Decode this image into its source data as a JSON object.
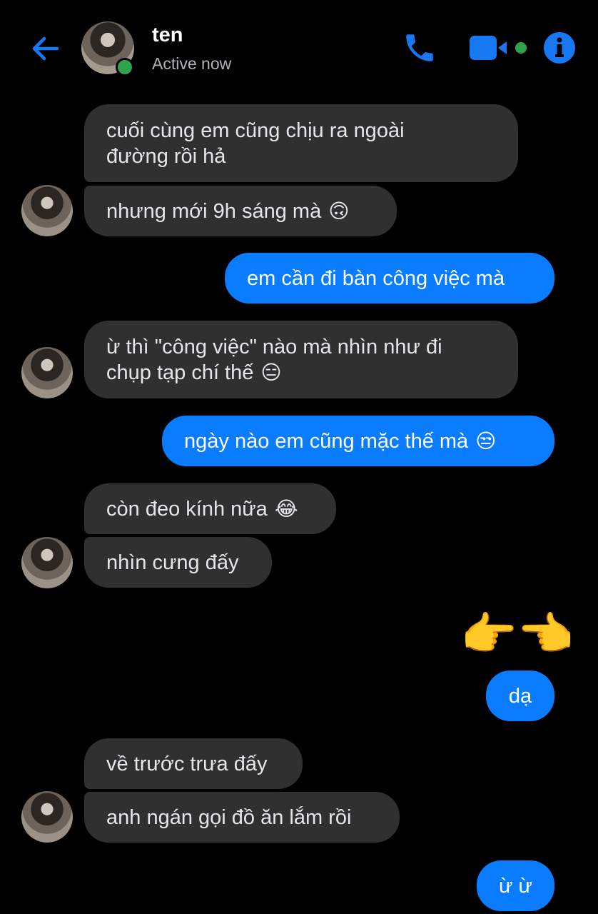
{
  "header": {
    "contact_name": "ten",
    "status": "Active now",
    "icons": {
      "back": "back-arrow-icon",
      "call": "phone-icon",
      "video": "video-camera-icon",
      "info": "info-icon"
    },
    "accent_color": "#1877f2",
    "online_color": "#31a24c"
  },
  "messages": [
    {
      "from": "them",
      "text": "cuối cùng em cũng chịu ra ngoài",
      "text2": "đường rồi hả"
    },
    {
      "from": "them",
      "text": "nhưng mới 9h sáng mà",
      "emoji": "🙃"
    },
    {
      "from": "me",
      "text": "em cần đi bàn công việc mà"
    },
    {
      "from": "them",
      "text": "ừ thì \"công việc\" nào mà nhìn như đi",
      "text2": "chụp tạp chí thế",
      "emoji": "😑"
    },
    {
      "from": "me",
      "text": "ngày nào em cũng mặc thế mà",
      "emoji": "😒"
    },
    {
      "from": "them",
      "text": "còn đeo kính nữa",
      "emoji": "😂"
    },
    {
      "from": "them",
      "text": "nhìn cưng đấy"
    },
    {
      "from": "me",
      "emoji_only": "👉👈"
    },
    {
      "from": "me",
      "text": "dạ"
    },
    {
      "from": "them",
      "text": "về trước trưa đấy"
    },
    {
      "from": "them",
      "text": "anh ngán gọi đồ ăn lắm rồi"
    },
    {
      "from": "me",
      "text": "ừ ừ"
    }
  ],
  "colors": {
    "background": "#000000",
    "incoming_bubble": "#303030",
    "outgoing_bubble": "#0a7cff"
  }
}
